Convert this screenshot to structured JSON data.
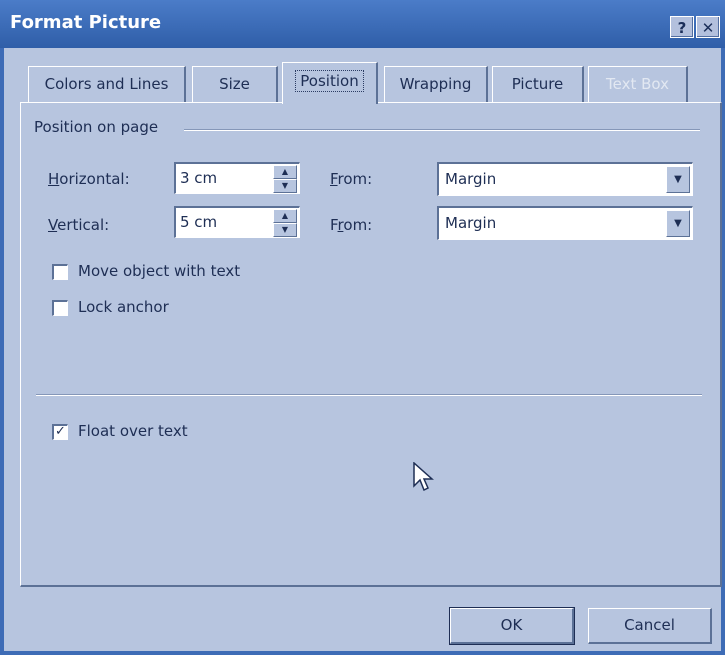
{
  "window": {
    "title": "Format Picture",
    "help_label": "?",
    "close_label": "✕"
  },
  "tabs": [
    {
      "label": "Colors and Lines",
      "active": false,
      "disabled": false
    },
    {
      "label": "Size",
      "active": false,
      "disabled": false
    },
    {
      "label": "Position",
      "active": true,
      "disabled": false
    },
    {
      "label": "Wrapping",
      "active": false,
      "disabled": false
    },
    {
      "label": "Picture",
      "active": false,
      "disabled": false
    },
    {
      "label": "Text Box",
      "active": false,
      "disabled": true
    }
  ],
  "position_on_page": {
    "group_label": "Position on page",
    "horizontal": {
      "label": "Horizontal:",
      "accelerator": "H",
      "value": "3 cm",
      "from_label": "From:",
      "from_accelerator": "F",
      "from_value": "Margin"
    },
    "vertical": {
      "label": "Vertical:",
      "accelerator": "V",
      "value": "5 cm",
      "from_label": "From:",
      "from_accelerator": "r",
      "from_value": "Margin"
    }
  },
  "options": {
    "move_with_text": {
      "label": "Move object with text",
      "checked": false
    },
    "lock_anchor": {
      "label": "Lock anchor",
      "checked": false
    },
    "float_over_text": {
      "label": "Float over text",
      "checked": true
    }
  },
  "buttons": {
    "ok_label": "OK",
    "cancel_label": "Cancel"
  },
  "colors": {
    "title_bar": "#3e6cb6",
    "dialog_face": "#b7c5df",
    "text": "#1e2e54"
  },
  "icons": {
    "cursor": "arrow-cursor-icon",
    "spin_up": "spin-up-icon",
    "spin_down": "spin-down-icon",
    "dropdown": "chevron-down-icon",
    "check": "checkmark-icon",
    "help": "help-icon",
    "close": "close-icon"
  }
}
